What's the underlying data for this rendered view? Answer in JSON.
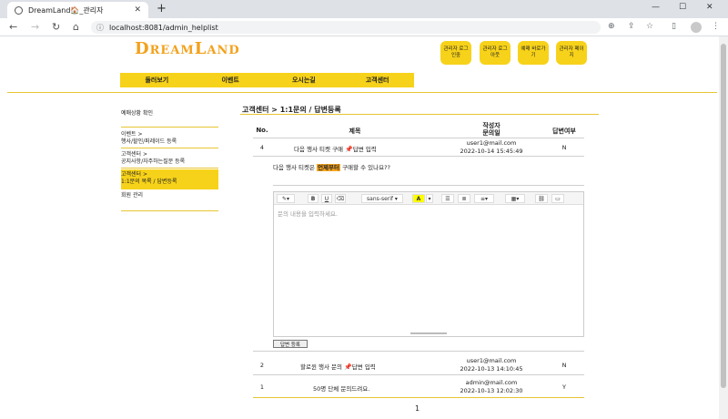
{
  "browser": {
    "tab_title": "DreamLand🏠_관리자",
    "url": "localhost:8081/admin_helplist"
  },
  "header": {
    "logo": "DreamLand",
    "admin_buttons": [
      {
        "label": "관리자 로그인중"
      },
      {
        "label": "관리자 로그아웃"
      },
      {
        "label": "예매 바로가기"
      },
      {
        "label": "관리자 페이지"
      }
    ],
    "menu": [
      "둘러보기",
      "이벤트",
      "오시는길",
      "고객센터"
    ]
  },
  "sidebar": {
    "items": [
      {
        "label": "예매상황 확인"
      },
      {
        "label": "이벤트 >\n행사/할인/퍼레이드 등록"
      },
      {
        "label": "고객센터 >\n공지사항/자주하는질문 등록"
      },
      {
        "label": "고객센터 >\n1:1문의 목록 / 답변등록"
      },
      {
        "label": "회원 관리"
      }
    ]
  },
  "main": {
    "title": "고객센터 > 1:1문의 / 답변등록",
    "columns": [
      "No.",
      "제목",
      "작성자\n문의일",
      "답변여부"
    ],
    "rows": [
      {
        "no": "4",
        "title": "다음 행사 티켓 구매",
        "reply_link": "답변 입력",
        "author": "user1@mail.com",
        "date": "2022-10-14 15:45:49",
        "answered": "N"
      },
      {
        "no": "2",
        "title": "할로윈 행사 문의",
        "reply_link": "답변 입력",
        "author": "user1@mail.com",
        "date": "2022-10-13 14:10:45",
        "answered": "N"
      },
      {
        "no": "1",
        "title": "50명 단체 문의드려요.",
        "reply_link": "",
        "author": "admin@mail.com",
        "date": "2022-10-13 12:02:30",
        "answered": "Y"
      }
    ],
    "question_pre": "다음 행사 티켓은",
    "question_highlight": "언제부터",
    "question_post": "구매할 수 있나요??",
    "editor": {
      "placeholder": "문의 내용을 입력하세요.",
      "font": "sans-serif",
      "submit_label": "답변 등록"
    },
    "pagination": "1"
  },
  "colors": {
    "accent": "#f7d21a",
    "logo": "#f3a11b",
    "highlight": "#f5a623"
  }
}
